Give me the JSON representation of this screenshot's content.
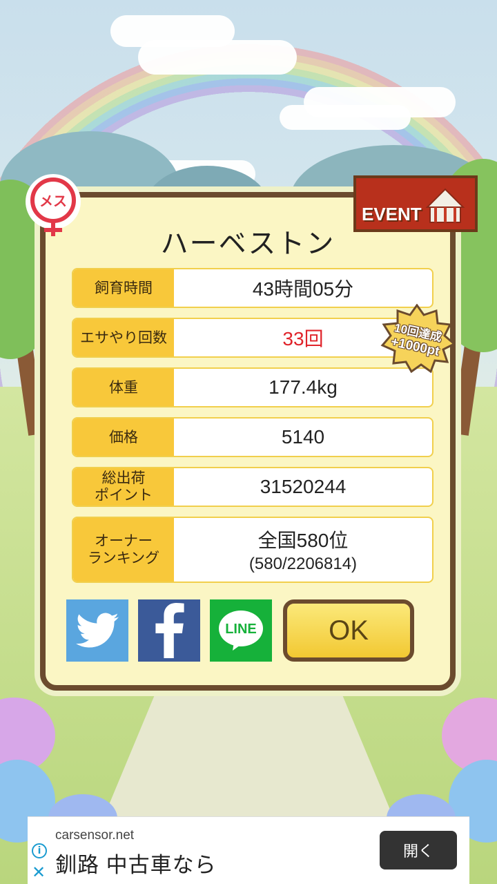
{
  "pet": {
    "name": "ハーベストン",
    "gender_badge": "メス"
  },
  "event_badge": {
    "label": "EVENT"
  },
  "bonus_badge": {
    "line1": "10回達成",
    "line2": "+1000pt"
  },
  "stats": [
    {
      "label": "飼育時間",
      "value": "43時間05分"
    },
    {
      "label": "エサやり回数",
      "value": "33回",
      "color": "#e0242b"
    },
    {
      "label": "体重",
      "value": "177.4kg"
    },
    {
      "label": "価格",
      "value": "5140"
    },
    {
      "label_lines": [
        "総出荷",
        "ポイント"
      ],
      "value": "31520244"
    },
    {
      "label_lines": [
        "オーナー",
        "ランキング"
      ],
      "value": "全国580位",
      "sub_value": "(580/2206814)"
    }
  ],
  "share": {
    "twitter_icon": "twitter-bird-icon",
    "facebook_icon": "facebook-f-icon",
    "line_label": "LINE"
  },
  "ok_label": "OK",
  "ad": {
    "domain": "carsensor.net",
    "headline": "釧路 中古車なら",
    "open_label": "開く",
    "info_icon": "i",
    "close_icon": "✕"
  }
}
